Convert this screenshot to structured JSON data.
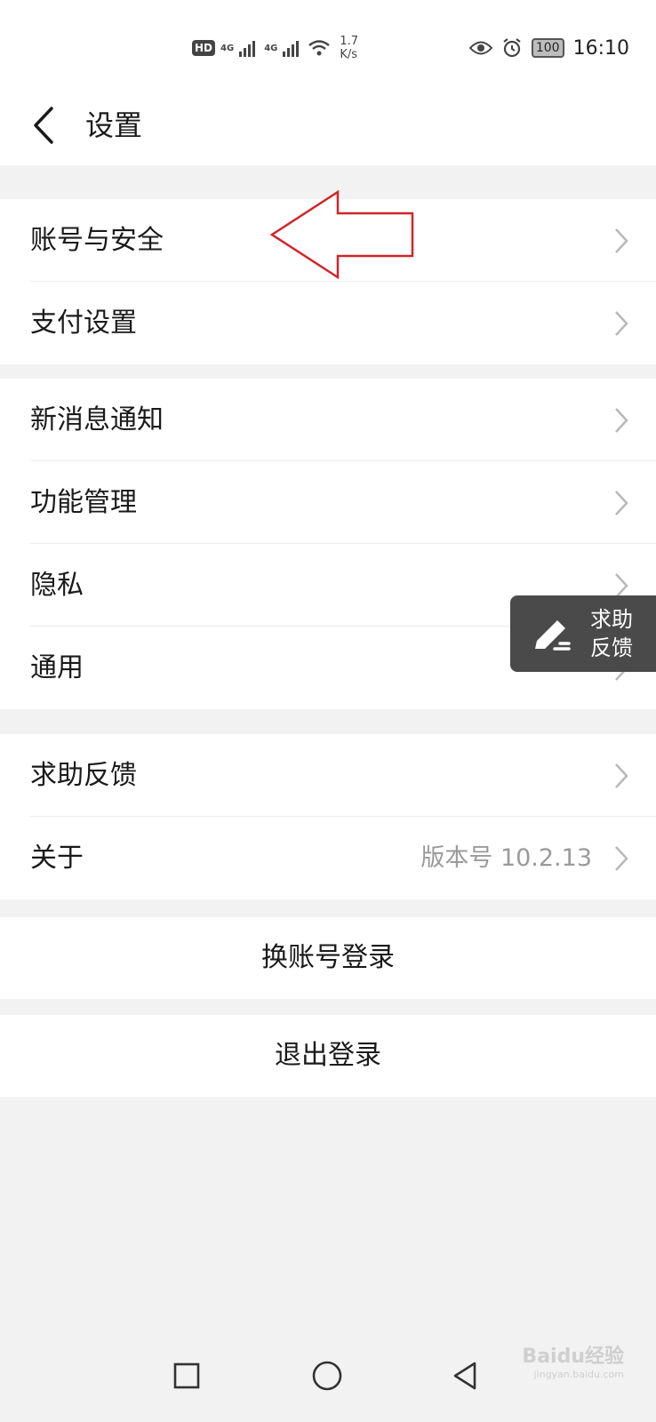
{
  "status_bar": {
    "hd": "HD",
    "net1": "4G",
    "net2": "4G",
    "speed_value": "1.7",
    "speed_unit": "K/s",
    "battery": "100",
    "time": "16:10"
  },
  "header": {
    "title": "设置"
  },
  "groups": [
    {
      "items": [
        {
          "label": "账号与安全"
        },
        {
          "label": "支付设置"
        }
      ]
    },
    {
      "items": [
        {
          "label": "新消息通知"
        },
        {
          "label": "功能管理"
        },
        {
          "label": "隐私"
        },
        {
          "label": "通用"
        }
      ]
    },
    {
      "items": [
        {
          "label": "求助反馈"
        },
        {
          "label": "关于",
          "value": "版本号 10.2.13"
        }
      ]
    }
  ],
  "actions": {
    "switch_account": "换账号登录",
    "logout": "退出登录"
  },
  "floating_help": {
    "line1": "求助",
    "line2": "反馈"
  },
  "watermark": {
    "brand": "Baidu经验",
    "url": "jingyan.baidu.com"
  },
  "colors": {
    "annotation_arrow": "#d0252b",
    "float_bg": "#4a4a4a",
    "page_bg": "#f2f2f2"
  }
}
